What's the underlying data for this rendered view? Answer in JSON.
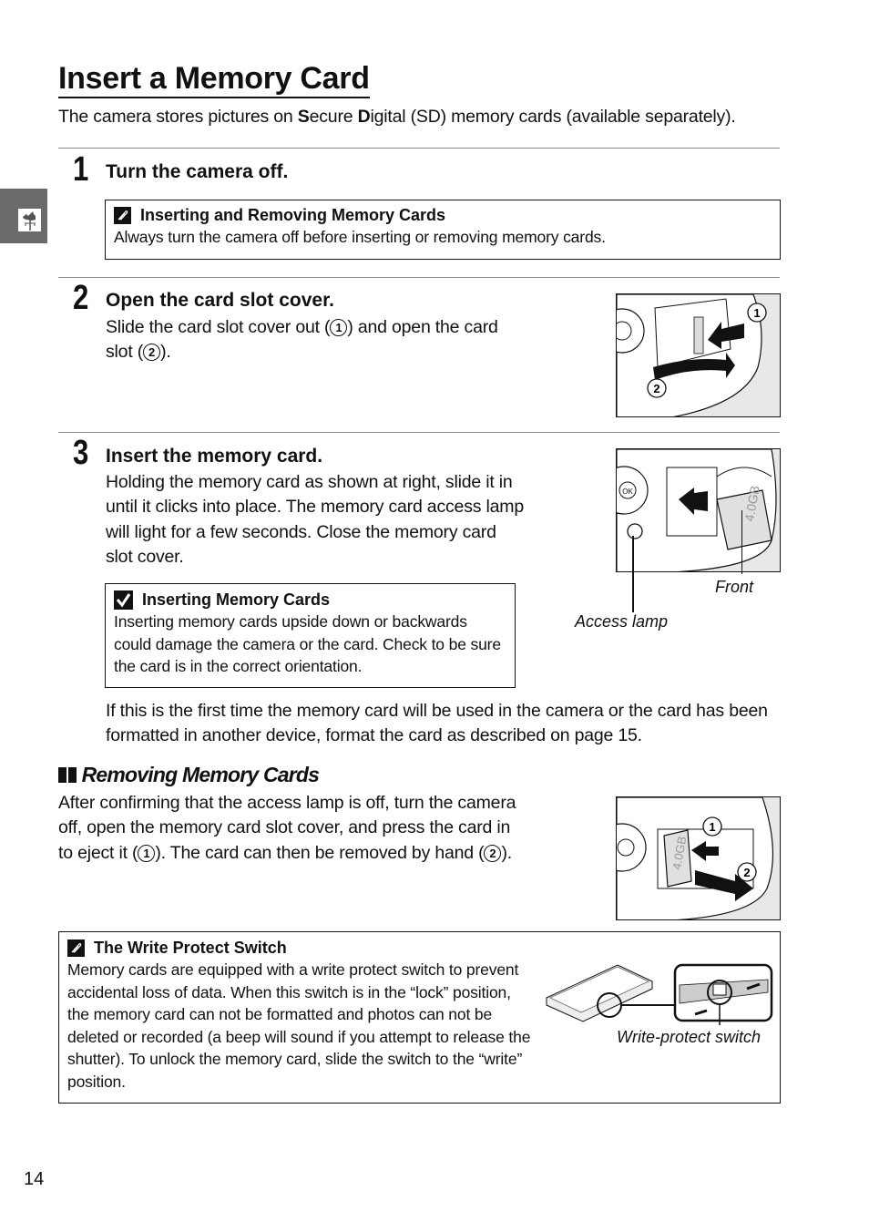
{
  "page": {
    "title": "Insert a Memory Card",
    "intro": {
      "before_s": "The camera stores pictures on ",
      "s": "S",
      "ecure": "ecure ",
      "d": "D",
      "after_d": "igital (SD) memory cards (available separately)."
    },
    "side_tab_icon": "weathervane-icon",
    "page_number": "14"
  },
  "steps": [
    {
      "number": "1",
      "title": "Turn the camera off.",
      "note": {
        "icon": "pencil-note-icon",
        "title": "Inserting and Removing Memory Cards",
        "body": "Always turn the camera off before inserting or removing memory cards."
      }
    },
    {
      "number": "2",
      "title": "Open the card slot cover.",
      "body_part1": "Slide the card slot cover out (",
      "marker1": "1",
      "body_part2": ") and open the card slot (",
      "marker2": "2",
      "body_part3": ").",
      "figure": {
        "callouts": [
          "1",
          "2"
        ]
      }
    },
    {
      "number": "3",
      "title": "Insert the memory card.",
      "body": "Holding the memory card as shown at right, slide it in until it clicks into place.  The memory card access lamp will light for a few seconds.  Close the memory card slot cover.",
      "caution": {
        "icon": "checkmark-caution-icon",
        "title": "Inserting Memory Cards",
        "body": "Inserting memory cards upside down or backwards could damage the camera or the card.  Check to be sure the card is in the correct orientation."
      },
      "figure": {
        "labels": {
          "front": "Front",
          "access_lamp": "Access lamp"
        },
        "card_text": "4.0GB"
      },
      "followup": "If this is the first time the memory card will be used in the camera or the card has been formatted in another device, format the card as described on page 15."
    }
  ],
  "removing": {
    "heading": "Removing Memory Cards",
    "body_part1": "After confirming that the access lamp is off, turn the camera off, open the memory card slot cover, and press the card in to eject it (",
    "marker1": "1",
    "body_part2": ").  The card can then be removed by hand (",
    "marker2": "2",
    "body_part3": ").",
    "figure": {
      "callouts": [
        "1",
        "2"
      ],
      "card_text": "4.0GB"
    }
  },
  "write_protect": {
    "icon": "pencil-note-icon",
    "title": "The Write Protect Switch",
    "body": "Memory cards are equipped with a write protect switch to prevent accidental loss of data. When this switch is in the “lock” position, the memory card can not be formatted and photos can not be deleted or recorded (a beep will sound if you attempt to release the shutter).  To unlock the memory card, slide the switch to the “write” position.",
    "figure_caption": "Write-protect switch"
  }
}
